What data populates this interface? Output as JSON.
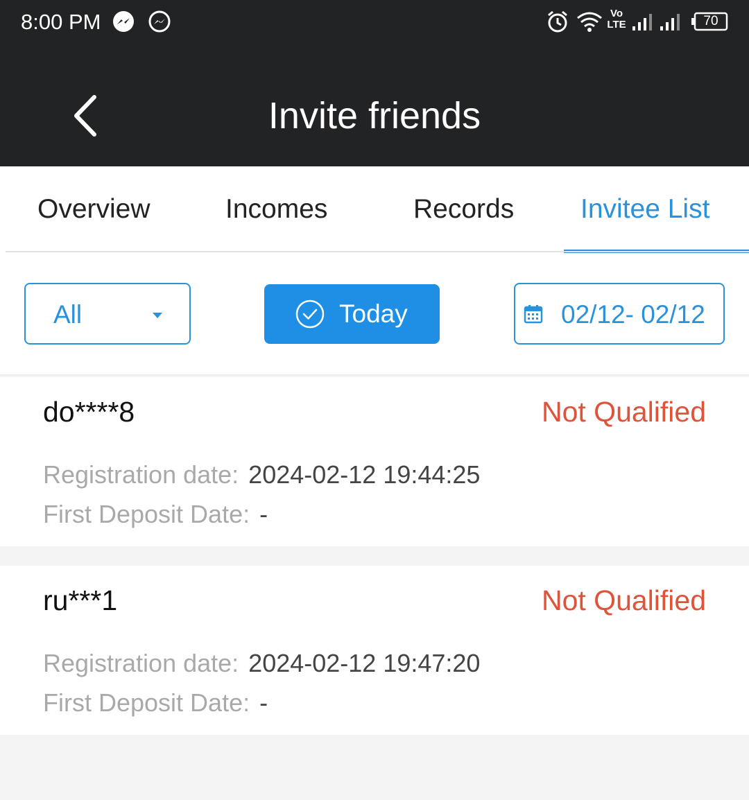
{
  "status_bar": {
    "time": "8:00 PM",
    "network_label": "Vo LTE",
    "battery": "70",
    "icons": [
      "messenger-icon",
      "messenger-outline-icon",
      "alarm-icon",
      "wifi-icon",
      "signal-icon",
      "signal-icon",
      "battery-icon"
    ]
  },
  "header": {
    "title": "Invite friends",
    "back_icon": "chevron-left-icon"
  },
  "tabs": [
    {
      "label": "Overview",
      "active": false
    },
    {
      "label": "Incomes",
      "active": false
    },
    {
      "label": "Records",
      "active": false
    },
    {
      "label": "Invitee List",
      "active": true
    }
  ],
  "filters": {
    "select_value": "All",
    "today_label": "Today",
    "date_range": "02/12- 02/12",
    "accent_color": "#2a91db"
  },
  "invitees": [
    {
      "name": "do****8",
      "status": "Not Qualified",
      "registration_label": "Registration date:",
      "registration_value": "2024-02-12 19:44:25",
      "deposit_label": "First Deposit Date:",
      "deposit_value": "-"
    },
    {
      "name": "ru***1",
      "status": "Not Qualified",
      "registration_label": "Registration date:",
      "registration_value": "2024-02-12 19:47:20",
      "deposit_label": "First Deposit Date:",
      "deposit_value": "-"
    }
  ],
  "colors": {
    "header_bg": "#222324",
    "status_not_qualified": "#e0533b",
    "primary_button": "#1e8fe4"
  }
}
